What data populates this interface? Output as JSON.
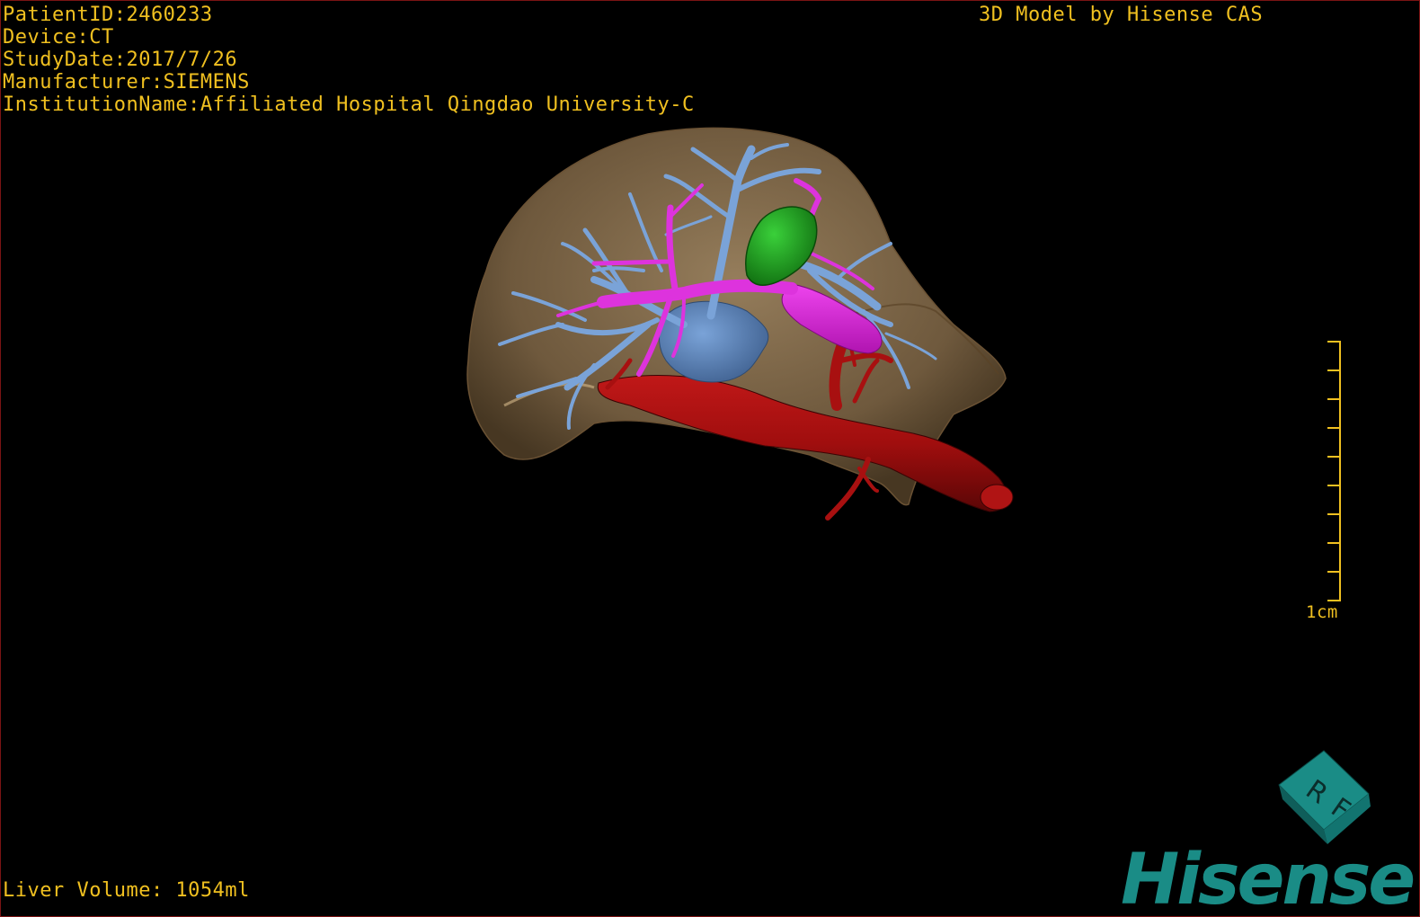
{
  "header": {
    "patient_id": "PatientID:2460233",
    "device": "Device:CT",
    "study_date": "StudyDate:2017/7/26",
    "manufacturer": "Manufacturer:SIEMENS",
    "institution": "InstitutionName:Affiliated Hospital Qingdao University-C",
    "credit": "3D Model by Hisense CAS"
  },
  "footer": {
    "liver_volume": "Liver Volume: 1054ml"
  },
  "scale_bar": {
    "label": "1cm"
  },
  "orientation_cube": {
    "faces": [
      "R",
      "F"
    ]
  },
  "brand": {
    "logo_text": "Hisense"
  },
  "colors": {
    "overlay_text": "#f0c020",
    "border": "#7a1414",
    "liver": "#b8986a",
    "hepatic_vein": "#6f98cc",
    "portal_vein": "#d424d4",
    "artery": "#a01010",
    "gallbladder": "#1fa61f",
    "brand": "#1a8c86"
  }
}
